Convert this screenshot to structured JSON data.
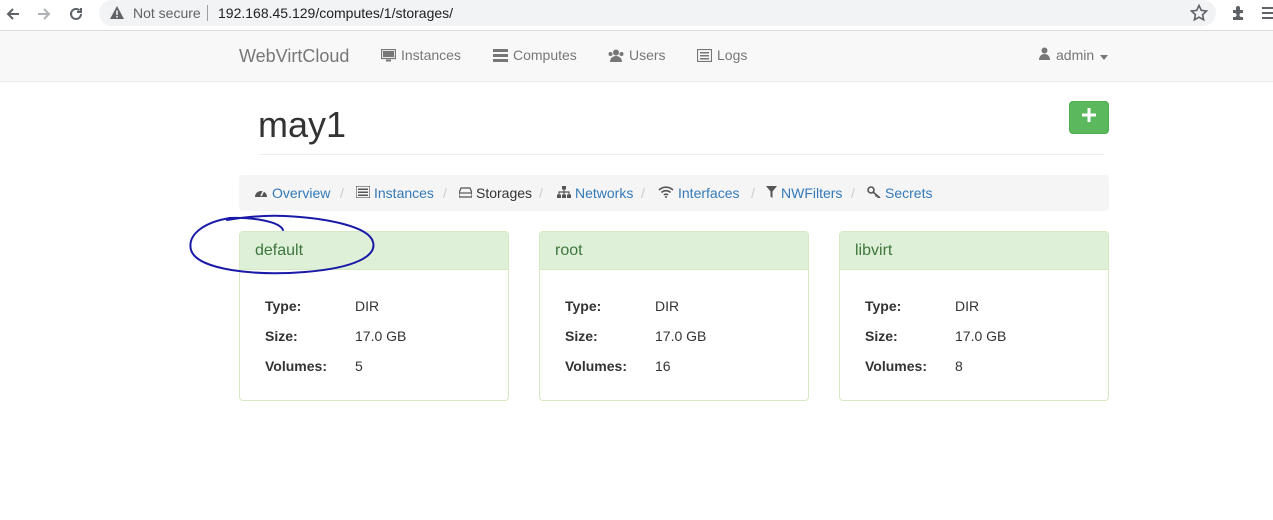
{
  "browser": {
    "security_label": "Not secure",
    "url": "192.168.45.129/computes/1/storages/",
    "icons": [
      "back-icon",
      "forward-icon",
      "reload-icon",
      "warning-icon",
      "star-icon",
      "extensions-icon",
      "menu-icon"
    ]
  },
  "navbar": {
    "brand": "WebVirtCloud",
    "links": [
      {
        "label": "Instances",
        "icon": "monitor-icon"
      },
      {
        "label": "Computes",
        "icon": "server-icon"
      },
      {
        "label": "Users",
        "icon": "users-icon"
      },
      {
        "label": "Logs",
        "icon": "list-icon"
      }
    ],
    "user": {
      "label": "admin",
      "icon": "user-icon"
    }
  },
  "page": {
    "title": "may1",
    "add_button_icon": "plus-icon",
    "add_button_label": "+",
    "add_button_color": "#5cb85c"
  },
  "subnav": {
    "items": [
      {
        "label": "Overview",
        "icon": "dashboard-icon",
        "active": false
      },
      {
        "label": "Instances",
        "icon": "list-icon",
        "active": false
      },
      {
        "label": "Storages",
        "icon": "hdd-icon",
        "active": true
      },
      {
        "label": "Networks",
        "icon": "sitemap-icon",
        "active": false
      },
      {
        "label": "Interfaces",
        "icon": "wifi-icon",
        "active": false
      },
      {
        "label": "NWFilters",
        "icon": "filter-icon",
        "active": false
      },
      {
        "label": "Secrets",
        "icon": "key-icon",
        "active": false
      }
    ],
    "separator": "/"
  },
  "storages": [
    {
      "name": "default",
      "type_label": "Type:",
      "type": "DIR",
      "size_label": "Size:",
      "size": "17.0 GB",
      "volumes_label": "Volumes:",
      "volumes": "5"
    },
    {
      "name": "root",
      "type_label": "Type:",
      "type": "DIR",
      "size_label": "Size:",
      "size": "17.0 GB",
      "volumes_label": "Volumes:",
      "volumes": "16"
    },
    {
      "name": "libvirt",
      "type_label": "Type:",
      "type": "DIR",
      "size_label": "Size:",
      "size": "17.0 GB",
      "volumes_label": "Volumes:",
      "volumes": "8"
    }
  ],
  "colors": {
    "panel_heading_bg": "#dff0d8",
    "panel_heading_text": "#3c763d",
    "link": "#337ab7",
    "annotation": "#1a1aa8"
  }
}
